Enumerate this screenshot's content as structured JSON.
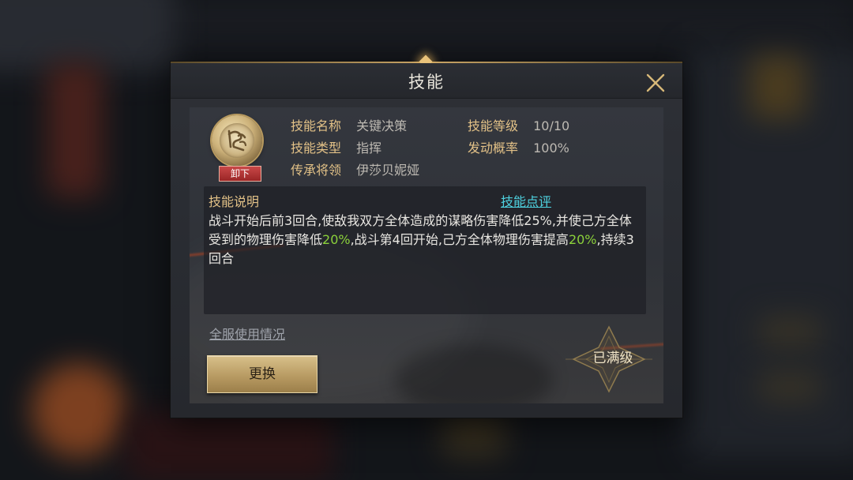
{
  "dialog": {
    "title": "技能",
    "close_icon": "close-icon"
  },
  "skill": {
    "icon": "skill-emblem-icon",
    "unequip_label": "卸下",
    "name_label": "技能名称",
    "name_value": "关键决策",
    "level_label": "技能等级",
    "level_value": "10/10",
    "type_label": "技能类型",
    "type_value": "指挥",
    "rate_label": "发动概率",
    "rate_value": "100%",
    "inherit_label": "传承将领",
    "inherit_value": "伊莎贝妮娅"
  },
  "description": {
    "title": "技能说明",
    "review_link": "技能点评",
    "segments": [
      "战斗开始后前3回合,使敌我双方全体造成的谋略伤害降低25%,并使己方全体受到的物理伤害降低",
      "20%",
      ",战斗第4回开始,己方全体物理伤害提高",
      "20%",
      ",持续3回合"
    ]
  },
  "footer": {
    "usage_link": "全服使用情况",
    "change_button": "更换",
    "maxed_label": "已满级"
  },
  "colors": {
    "gold_label": "#e2c187",
    "highlight_green": "#8bd13b",
    "link_cyan": "#4ed2e0",
    "unequip_red": "#b83232"
  }
}
